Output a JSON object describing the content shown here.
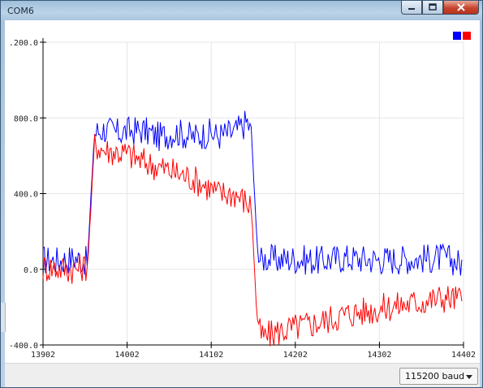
{
  "window": {
    "title": "COM6",
    "buttons": [
      "minimize-icon",
      "maximize-icon",
      "close-icon"
    ]
  },
  "footer": {
    "baud_label": "115200 baud"
  },
  "colors": {
    "series1": "#0000ff",
    "series2": "#ff0000",
    "grid": "#e6e6e6",
    "axis": "#000000"
  },
  "legend": {
    "placement": "top-right",
    "swatches": [
      "#0000ff",
      "#ff0000"
    ]
  },
  "chart_data": {
    "type": "line",
    "title": "",
    "xlabel": "",
    "ylabel": "",
    "xlim": [
      13902,
      14402
    ],
    "ylim": [
      -400,
      1200
    ],
    "x_ticks": [
      "13902",
      "14002",
      "14102",
      "14202",
      "14302",
      "14402"
    ],
    "y_ticks": [
      ".200.0",
      "800.0",
      "400.0",
      "0.0",
      "-400.0"
    ],
    "grid": true,
    "x": [
      13902,
      13920,
      13940,
      13955,
      13958,
      13963,
      13975,
      13990,
      14002,
      14020,
      14040,
      14060,
      14080,
      14100,
      14110,
      14130,
      14145,
      14150,
      14155,
      14158,
      14162,
      14165,
      14180,
      14200,
      14230,
      14260,
      14300,
      14340,
      14380,
      14400
    ],
    "series": [
      {
        "values": [
          50,
          45,
          60,
          40,
          300,
          720,
          740,
          720,
          730,
          735,
          700,
          725,
          700,
          720,
          705,
          725,
          780,
          710,
          250,
          70,
          40,
          60,
          50,
          55,
          45,
          60,
          50,
          55,
          60,
          30
        ]
      },
      {
        "values": [
          10,
          5,
          0,
          20,
          250,
          660,
          630,
          620,
          610,
          570,
          540,
          510,
          480,
          430,
          400,
          400,
          350,
          330,
          -150,
          -320,
          -350,
          -360,
          -330,
          -310,
          -280,
          -240,
          -210,
          -180,
          -150,
          -160
        ]
      }
    ]
  }
}
